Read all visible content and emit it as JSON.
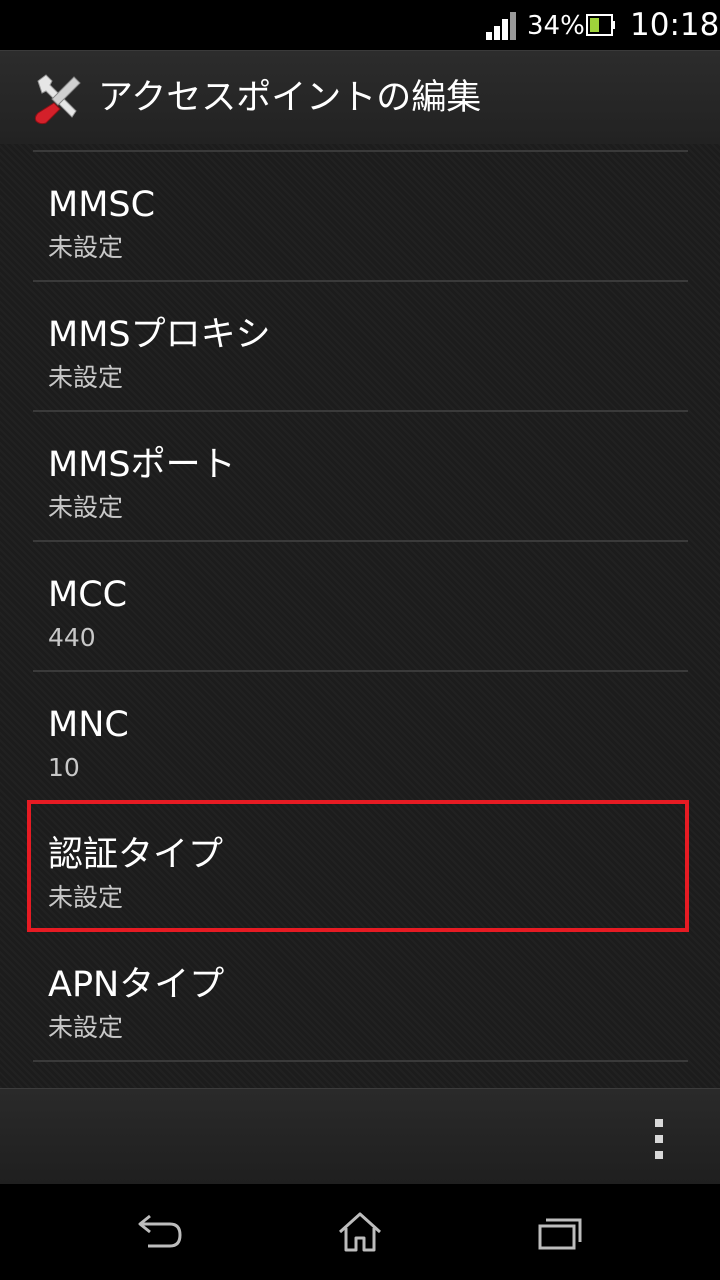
{
  "status_bar": {
    "battery_percent": "34%",
    "time": "10:18",
    "icons": [
      "signal-icon",
      "battery-icon"
    ]
  },
  "action_bar": {
    "title": "アクセスポイントの編集",
    "icon": "tools-icon"
  },
  "preferences": [
    {
      "title": "MMSC",
      "summary": "未設定"
    },
    {
      "title": "MMSプロキシ",
      "summary": "未設定"
    },
    {
      "title": "MMSポート",
      "summary": "未設定"
    },
    {
      "title": "MCC",
      "summary": "440"
    },
    {
      "title": "MNC",
      "summary": "10"
    },
    {
      "title": "認証タイプ",
      "summary": "未設定"
    },
    {
      "title": "APNタイプ",
      "summary": "未設定"
    }
  ],
  "highlighted_item": "認証タイプ",
  "colors": {
    "highlight": "#e61b23",
    "background": "#1c1c1c",
    "divider": "#3a3a3a"
  },
  "nav_bar": {
    "icons": [
      "back-icon",
      "home-icon",
      "recent-apps-icon"
    ]
  },
  "menu_bar": {
    "icon": "overflow-menu-icon"
  }
}
